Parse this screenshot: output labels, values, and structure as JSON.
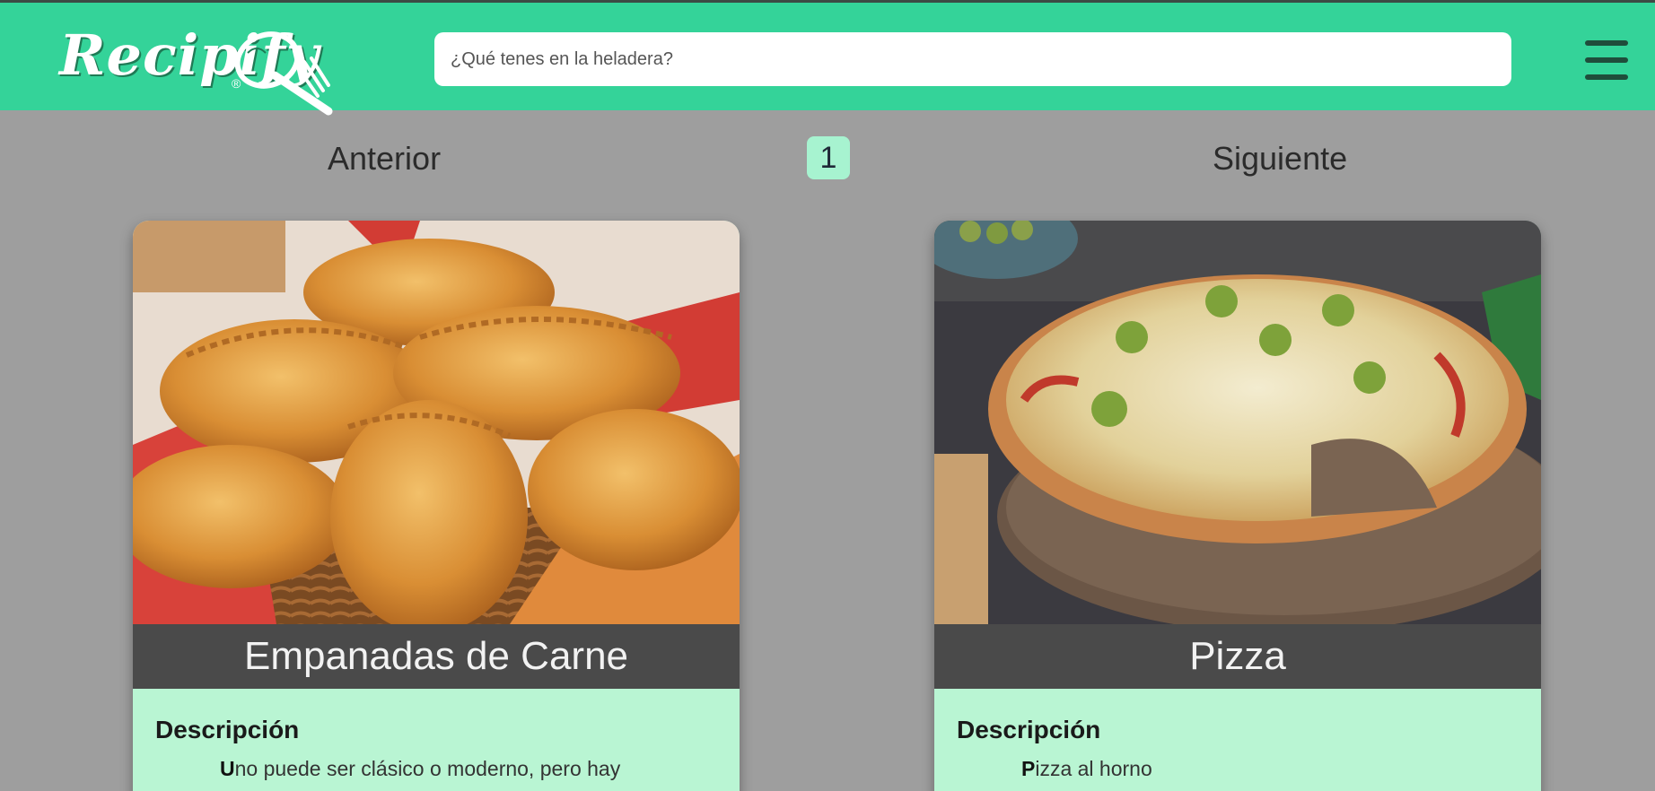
{
  "brand": {
    "name": "Recipify",
    "reg_mark": "®"
  },
  "search": {
    "placeholder": "¿Qué tenes en la heladera?",
    "value": ""
  },
  "menu": {
    "icon": "hamburger-menu-icon"
  },
  "pagination": {
    "prev_label": "Anterior",
    "current_page": "1",
    "next_label": "Siguiente"
  },
  "recipes": [
    {
      "title": "Empanadas de Carne",
      "image": "empanadas-photo",
      "description_heading": "Descripción",
      "description_initial": "U",
      "description_rest": "no puede ser clásico o moderno, pero hay"
    },
    {
      "title": "Pizza",
      "image": "pizza-photo",
      "description_heading": "Descripción",
      "description_initial": "P",
      "description_rest": "izza al horno"
    }
  ],
  "colors": {
    "header": "#34d399",
    "background": "#9e9e9e",
    "card_body": "#b9f5d3",
    "card_title_bar": "#4a4a4a",
    "page_badge": "#a7f3d0"
  }
}
